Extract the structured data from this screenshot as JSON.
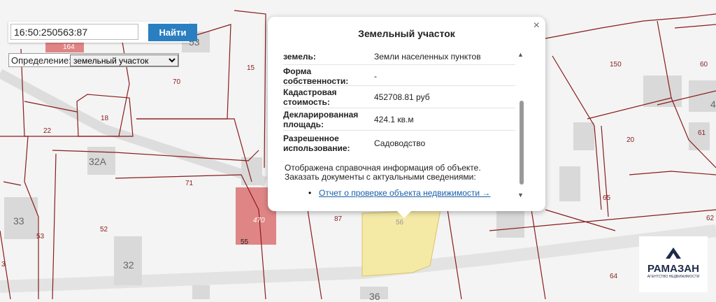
{
  "search": {
    "value": "16:50:250563:87",
    "button_label": "Найти"
  },
  "definition": {
    "label": "Определение:",
    "selected": "земельный участок"
  },
  "map_labels": [
    "164",
    "53",
    "15",
    "70",
    "150",
    "60",
    "18",
    "22",
    "20",
    "61",
    "32A",
    "71",
    "65",
    "470",
    "87",
    "56",
    "55",
    "53",
    "52",
    "33",
    "32",
    "3",
    "64",
    "62",
    "36",
    "4"
  ],
  "popup": {
    "title": "Земельный участок",
    "close": "×",
    "rows": [
      {
        "key": "земель:",
        "value": "Земли населенных пунктов"
      },
      {
        "key": "Форма собственности:",
        "value": "-"
      },
      {
        "key": "Кадастровая стоимость:",
        "value": "452708.81 руб"
      },
      {
        "key": "Декларированная площадь:",
        "value": "424.1 кв.м"
      },
      {
        "key": "Разрешенное использование:",
        "value": "Садоводство"
      }
    ],
    "note": "Отображена справочная информация об объекте. Заказать документы с актуальными сведениями:",
    "report_link": "Отчет о проверке объекта недвижимости →"
  },
  "logo": {
    "name": "РАМАЗАН",
    "sub": "АГЕНТСТВО НЕДВИЖИМОСТИ"
  },
  "colors": {
    "parcel_line": "#8a1c1c",
    "highlight_parcel": "#f5e9a6",
    "selected_building": "#dd7b7b",
    "button": "#2a7fc1"
  }
}
